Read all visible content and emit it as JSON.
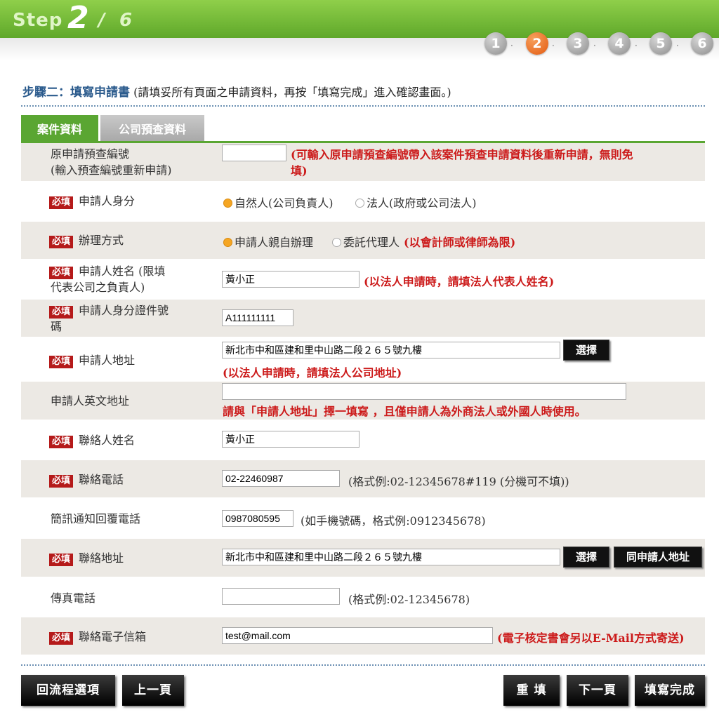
{
  "step": {
    "label": "Step",
    "current": "2",
    "sep": "/",
    "total": "6",
    "dots": [
      "1",
      "2",
      "3",
      "4",
      "5",
      "6"
    ],
    "active": "2",
    "dot_sep": "·"
  },
  "title": {
    "main": "步驟二：填寫申請書",
    "sub": "(請填妥所有頁面之申請資料，再按「填寫完成」進入確認畫面。)"
  },
  "tabs": [
    "案件資料",
    "公司預查資料"
  ],
  "required_badge": "必填",
  "form": {
    "orig_no": {
      "label1": "原申請預查編號",
      "label2": "(輸入預查編號重新申請)",
      "value": "",
      "hint1": "(可輸入原申請預查編號帶入該案件預查申請資料後重新申請，無則免",
      "hint2": "填)"
    },
    "identity": {
      "label": "申請人身分",
      "opt1": "自然人(公司負責人)",
      "opt2": "法人(政府或公司法人)"
    },
    "method": {
      "label": "辦理方式",
      "opt1": "申請人親自辦理",
      "opt2": "委託代理人",
      "note": "(以會計師或律師為限)"
    },
    "name": {
      "label1": "申請人姓名 (限填",
      "label2": "代表公司之負責人)",
      "value": "黃小正",
      "hint": "(以法人申請時，請填法人代表人姓名)"
    },
    "id_no": {
      "label1": "申請人身分證件號",
      "label2": "碼",
      "value": "A111111111"
    },
    "address": {
      "label": "申請人地址",
      "value": "新北市中和區建和里中山路二段２６５號九樓",
      "btn": "選擇",
      "hint": "(以法人申請時，請填法人公司地址)"
    },
    "en_address": {
      "label": "申請人英文地址",
      "value": "",
      "hint": "請與「申請人地址」擇一填寫 ，且僅申請人為外商法人或外國人時使用。"
    },
    "contact_name": {
      "label": "聯絡人姓名",
      "value": "黃小正"
    },
    "contact_tel": {
      "label": "聯絡電話",
      "value": "02-22460987",
      "hint": "(格式例:02-12345678#119 (分機可不填))"
    },
    "sms_tel": {
      "label": "簡訊通知回覆電話",
      "value": "0987080595",
      "hint": "(如手機號碼，格式例:0912345678)"
    },
    "contact_addr": {
      "label": "聯絡地址",
      "value": "新北市中和區建和里中山路二段２６５號九樓",
      "btn1": "選擇",
      "btn2": "同申請人地址"
    },
    "fax": {
      "label": "傳真電話",
      "value": "",
      "hint": "(格式例:02-12345678)"
    },
    "email": {
      "label": "聯絡電子信箱",
      "value": "test@mail.com",
      "hint": "(電子核定書會另以E-Mail方式寄送)"
    }
  },
  "buttons": {
    "back_flow": "回流程選項",
    "prev": "上一頁",
    "reset": "重 填",
    "next": "下一頁",
    "done": "填寫完成"
  }
}
